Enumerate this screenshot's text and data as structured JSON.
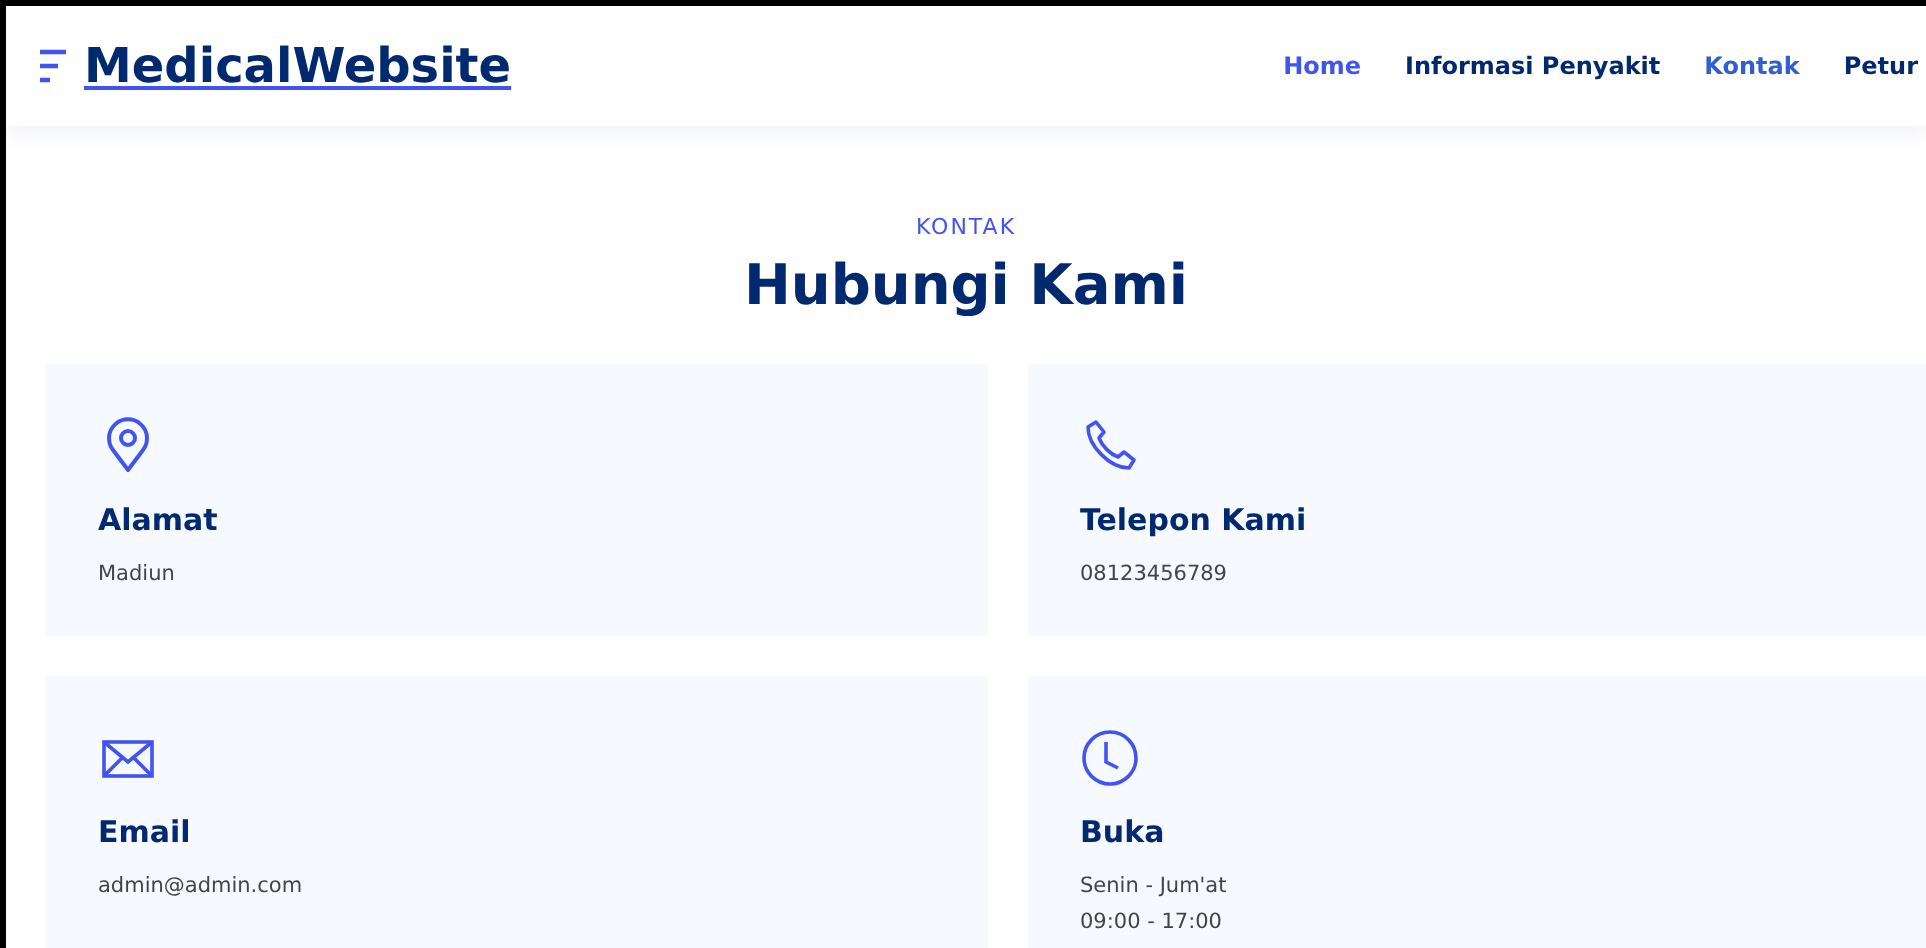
{
  "header": {
    "logo": "MedicalWebsite",
    "nav": [
      {
        "label": "Home",
        "selected": false,
        "hovered": true
      },
      {
        "label": "Informasi Penyakit",
        "selected": false,
        "hovered": false
      },
      {
        "label": "Kontak",
        "selected": true,
        "hovered": false
      },
      {
        "label": "Petur",
        "selected": false,
        "hovered": false
      }
    ]
  },
  "section": {
    "eyebrow": "KONTAK",
    "title": "Hubungi Kami"
  },
  "cards": [
    {
      "kind": "pin",
      "title": "Alamat",
      "lines": [
        "Madiun"
      ]
    },
    {
      "kind": "phone",
      "title": "Telepon Kami",
      "lines": [
        "08123456789"
      ]
    },
    {
      "kind": "mail",
      "title": "Email",
      "lines": [
        "admin@admin.com"
      ]
    },
    {
      "kind": "clock",
      "title": "Buka",
      "lines": [
        "Senin - Jum'at",
        "09:00 - 17:00"
      ]
    }
  ]
}
